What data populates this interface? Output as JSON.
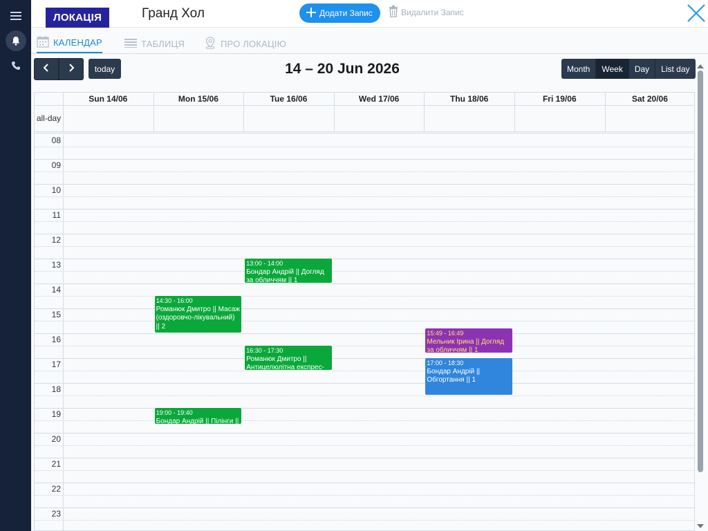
{
  "rail": {
    "items": [
      {
        "icon": "hamburger-menu-icon"
      },
      {
        "icon": "bell-icon",
        "active": true
      },
      {
        "icon": "phone-icon"
      }
    ]
  },
  "topbar": {
    "location_badge": "ЛОКАЦІЯ",
    "location_name": "Гранд Хол",
    "add_label": "Додати Запис",
    "delete_label": "Видалити Запис"
  },
  "tabs": [
    {
      "label": "КАЛЕНДАР",
      "icon": "calendar-icon",
      "active": true
    },
    {
      "label": "ТАБЛИЦЯ",
      "icon": "table-icon",
      "active": false
    },
    {
      "label": "ПРО ЛОКАЦІЮ",
      "icon": "location-pin-icon",
      "active": false
    }
  ],
  "calendar": {
    "today_label": "today",
    "range_title": "14 – 20 Jun 2026",
    "views": [
      {
        "label": "Month",
        "active": false
      },
      {
        "label": "Week",
        "active": true
      },
      {
        "label": "Day",
        "active": false
      },
      {
        "label": "List day",
        "active": false
      }
    ],
    "allday_label": "all-day",
    "days": [
      "Sun 14/06",
      "Mon 15/06",
      "Tue 16/06",
      "Wed 17/06",
      "Thu 18/06",
      "Fri 19/06",
      "Sat 20/06"
    ],
    "hours": [
      "08",
      "09",
      "10",
      "11",
      "12",
      "13",
      "14",
      "15",
      "16",
      "17",
      "18",
      "19",
      "20",
      "21",
      "22",
      "23"
    ],
    "events": [
      {
        "day": 2,
        "start": "13:00",
        "end": "14:00",
        "time": "13:00 - 14:00",
        "title": "Бондар Андрій || Догляд за обличчям || 1",
        "color": "#0aa83a",
        "text_color": "#ffffff"
      },
      {
        "day": 1,
        "start": "14:30",
        "end": "16:00",
        "time": "14:30 - 16:00",
        "title": "Романюк Дмитро || Масаж (оздоровчо-лікувальний) || 2",
        "color": "#0aa83a",
        "text_color": "#ffffff"
      },
      {
        "day": 2,
        "start": "16:30",
        "end": "17:30",
        "time": "16:30 - 17:30",
        "title": "Романюк Дмитро || Антицелюлітна експрес-",
        "color": "#0aa83a",
        "text_color": "#ffffff"
      },
      {
        "day": 1,
        "start": "19:00",
        "end": "19:40",
        "time": "19:00 - 19:40",
        "title": "Бондар Андрій || Пілінги ||",
        "color": "#0aa83a",
        "text_color": "#ffffff"
      },
      {
        "day": 4,
        "start": "15:49",
        "end": "16:49",
        "time": "15:49 - 16:49",
        "title": "Мельник Ірина || Догляд за обличчям || 1",
        "color": "#8e32b4",
        "text_color": "#ffe36b"
      },
      {
        "day": 4,
        "start": "17:00",
        "end": "18:30",
        "time": "17:00 - 18:30",
        "title": "Бондар Андрій || Обгортання || 1",
        "color": "#2f86dc",
        "text_color": "#ffffff"
      }
    ]
  }
}
